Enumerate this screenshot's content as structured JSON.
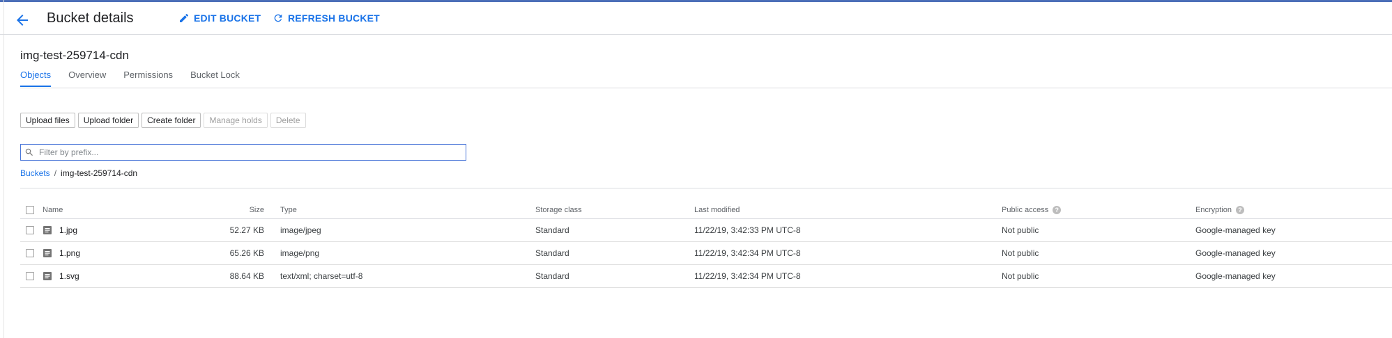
{
  "header": {
    "title": "Bucket details",
    "edit_label": "EDIT BUCKET",
    "refresh_label": "REFRESH BUCKET",
    "accent": "#1a73e8"
  },
  "bucket": {
    "name": "img-test-259714-cdn"
  },
  "tabs": [
    {
      "label": "Objects",
      "active": true
    },
    {
      "label": "Overview",
      "active": false
    },
    {
      "label": "Permissions",
      "active": false
    },
    {
      "label": "Bucket Lock",
      "active": false
    }
  ],
  "toolbar": {
    "upload_files": "Upload files",
    "upload_folder": "Upload folder",
    "create_folder": "Create folder",
    "manage_holds": "Manage holds",
    "delete": "Delete"
  },
  "filter": {
    "placeholder": "Filter by prefix..."
  },
  "breadcrumb": {
    "root": "Buckets",
    "separator": "/",
    "current": "img-test-259714-cdn"
  },
  "table": {
    "columns": {
      "name": "Name",
      "size": "Size",
      "type": "Type",
      "storage_class": "Storage class",
      "last_modified": "Last modified",
      "public_access": "Public access",
      "encryption": "Encryption"
    },
    "rows": [
      {
        "name": "1.jpg",
        "size": "52.27 KB",
        "type": "image/jpeg",
        "storage_class": "Standard",
        "last_modified": "11/22/19, 3:42:33 PM UTC-8",
        "public_access": "Not public",
        "encryption": "Google-managed key",
        "icon": "file-icon"
      },
      {
        "name": "1.png",
        "size": "65.26 KB",
        "type": "image/png",
        "storage_class": "Standard",
        "last_modified": "11/22/19, 3:42:34 PM UTC-8",
        "public_access": "Not public",
        "encryption": "Google-managed key",
        "icon": "file-icon"
      },
      {
        "name": "1.svg",
        "size": "88.64 KB",
        "type": "text/xml; charset=utf-8",
        "storage_class": "Standard",
        "last_modified": "11/22/19, 3:42:34 PM UTC-8",
        "public_access": "Not public",
        "encryption": "Google-managed key",
        "icon": "file-icon"
      }
    ]
  }
}
